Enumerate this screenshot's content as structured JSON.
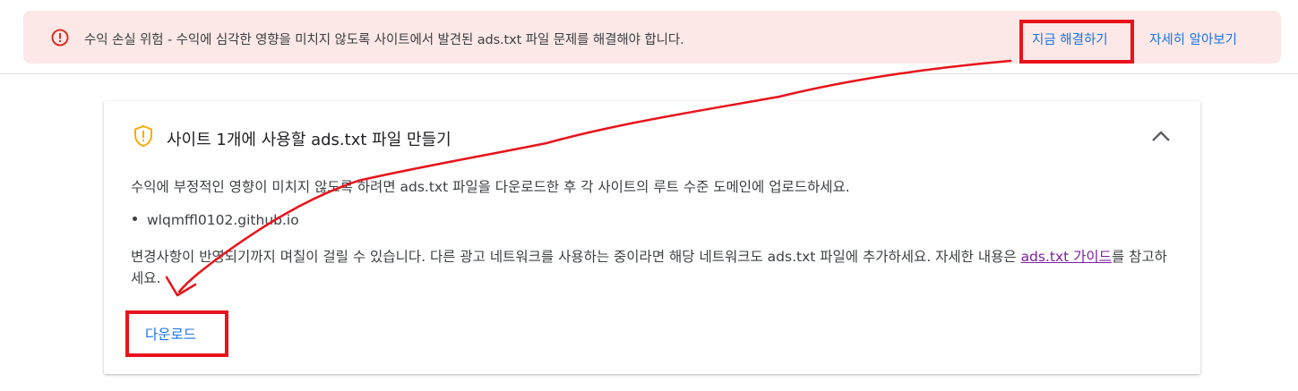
{
  "banner": {
    "message": "수익 손실 위험 - 수익에 심각한 영향을 미치지 않도록 사이트에서 발견된 ads.txt 파일 문제를 해결해야 합니다.",
    "fix_now": "지금 해결하기",
    "learn_more": "자세히 알아보기",
    "icon": "error-icon",
    "color": "#d93025"
  },
  "card": {
    "title": "사이트 1개에 사용할 ads.txt 파일 만들기",
    "icon": "shield-warning-icon",
    "description": "수익에 부정적인 영향이 미치지 않도록 하려면 ads.txt 파일을 다운로드한 후 각 사이트의 루트 수준 도메인에 업로드하세요.",
    "sites": [
      "wlqmffl0102.github.io"
    ],
    "note_before": "변경사항이 반영되기까지 며칠이 걸릴 수 있습니다. 다른 광고 네트워크를 사용하는 중이라면 해당 네트워크도 ads.txt 파일에 추가하세요. 자세한 내용은 ",
    "note_link": "ads.txt 가이드",
    "note_after": "를 참고하세요.",
    "download": "다운로드"
  },
  "colors": {
    "annotation_red": "#e8131b",
    "link_blue": "#1a73e8",
    "banner_bg": "#fce8e6"
  }
}
